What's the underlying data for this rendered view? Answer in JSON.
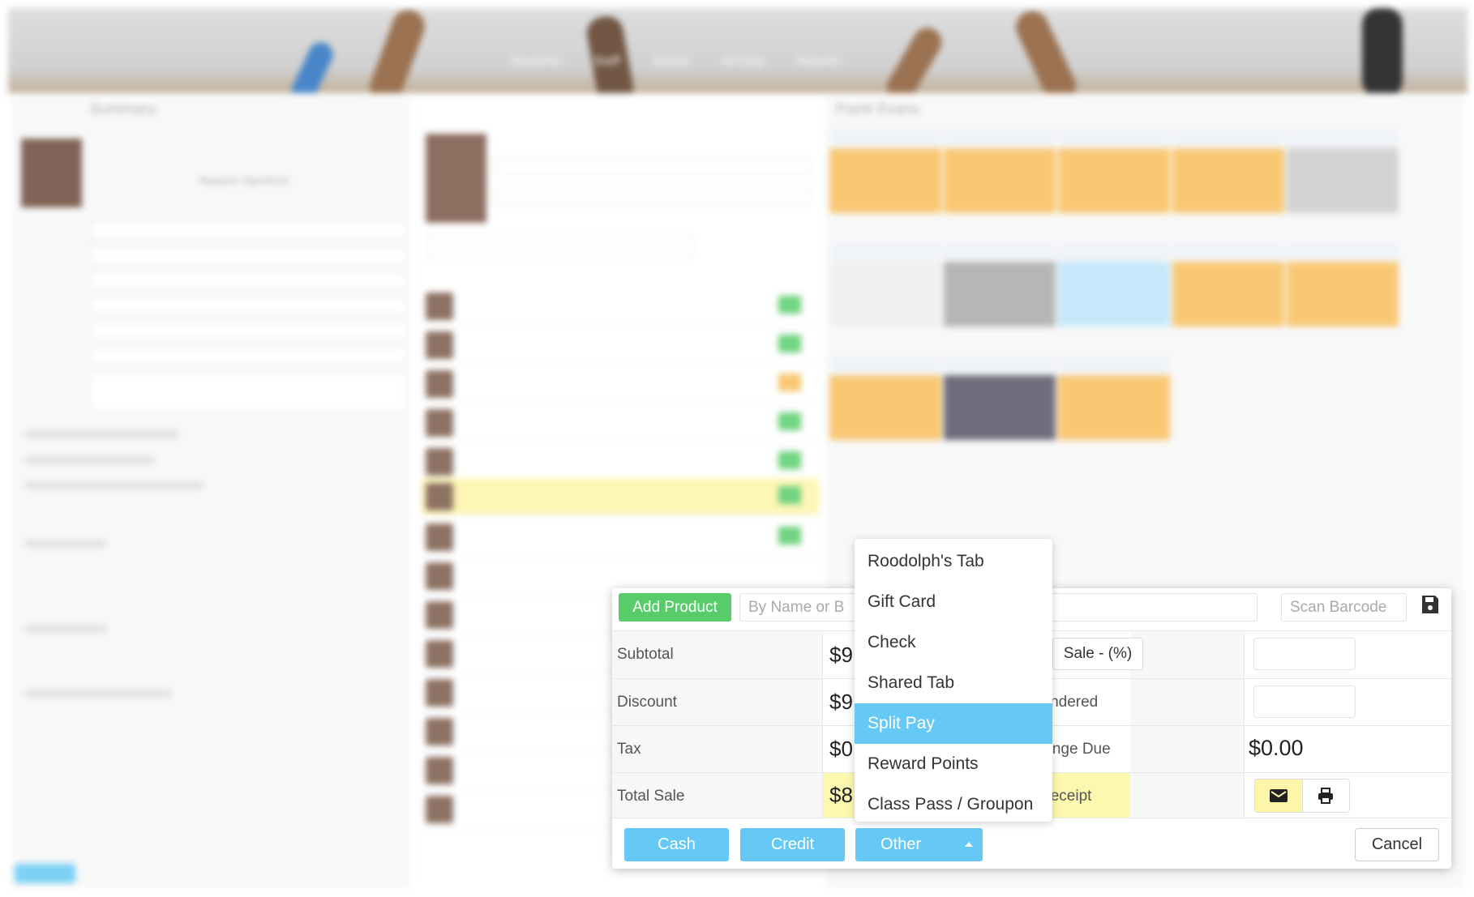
{
  "background": {
    "nav": [
      "Students",
      "Staff",
      "Assets",
      "Activity",
      "Reports"
    ],
    "left_panel_title": "Summary",
    "request_signature": "Request Signature",
    "right_panel_title": "Frank Evans"
  },
  "modal": {
    "add_product_label": "Add Product",
    "search_placeholder": "By Name or B",
    "scan_barcode_placeholder": "Scan Barcode",
    "save_icon": "floppy-disk-icon",
    "rows": [
      {
        "label": "Subtotal",
        "value": "$9"
      },
      {
        "label": "Discount",
        "value": "$9"
      },
      {
        "label": "Tax",
        "value": "$0"
      },
      {
        "label": "Total Sale",
        "value": "$8"
      }
    ],
    "discount_type_button": "Sale - (%)",
    "tendered_label": "Tendered",
    "change_due_label": "Change Due",
    "change_due_value": "$0.00",
    "receipt_label": "Receipt",
    "receipt_email_icon": "envelope-icon",
    "receipt_print_icon": "printer-icon",
    "cash_label": "Cash",
    "credit_label": "Credit",
    "other_label": "Other",
    "cancel_label": "Cancel",
    "accent_color": "#66c9f5",
    "add_color": "#58cc6a"
  },
  "dropdown": {
    "items": [
      "Roodolph's Tab",
      "Gift Card",
      "Check",
      "Shared Tab",
      "Split Pay",
      "Reward Points",
      "Class Pass / Groupon"
    ],
    "selected": "Split Pay"
  }
}
